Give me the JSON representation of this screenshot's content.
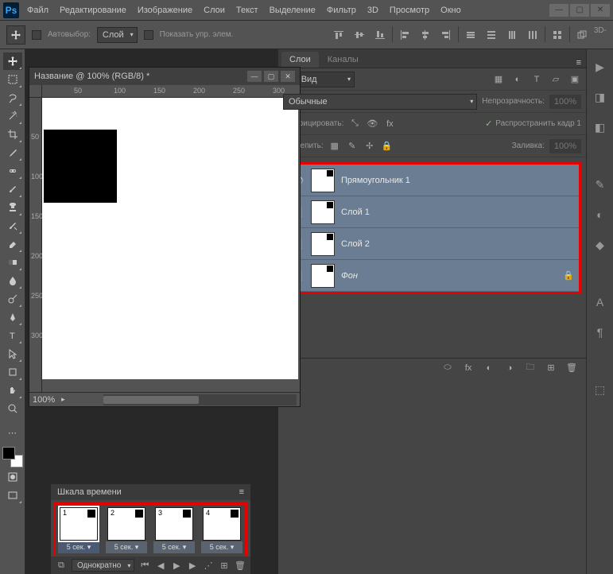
{
  "app": {
    "logo": "Ps"
  },
  "menu": [
    "Файл",
    "Редактирование",
    "Изображение",
    "Слои",
    "Текст",
    "Выделение",
    "Фильтр",
    "3D",
    "Просмотр",
    "Окно"
  ],
  "options": {
    "autoselect": "Автовыбор:",
    "autoselect_scope": "Слой",
    "show_controls": "Показать упр. элем.",
    "threeD": "3D-"
  },
  "doc": {
    "title": "Название @ 100% (RGB/8) *",
    "ruler_h": [
      "50",
      "100",
      "150",
      "200",
      "250",
      "300"
    ],
    "ruler_v": [
      "50",
      "100",
      "150",
      "200",
      "250",
      "300"
    ],
    "zoom": "100%"
  },
  "layers_panel": {
    "tabs": [
      "Слои",
      "Каналы"
    ],
    "search_label": "Вид",
    "blend": "Обычные",
    "opacity_label": "Непрозрачность:",
    "opacity_val": "100%",
    "unify_label": "Унифицировать:",
    "propagate": "Распространить кадр 1",
    "lock_label": "Закрепить:",
    "fill_label": "Заливка:",
    "fill_val": "100%",
    "layers": [
      {
        "name": "Прямоугольник 1",
        "visible": true,
        "locked": false
      },
      {
        "name": "Слой 1",
        "visible": false,
        "locked": false
      },
      {
        "name": "Слой 2",
        "visible": false,
        "locked": false
      },
      {
        "name": "Фон",
        "visible": false,
        "locked": true,
        "italic": true
      }
    ]
  },
  "timeline": {
    "title": "Шкала времени",
    "frames": [
      {
        "n": "1",
        "delay": "5 сек. ▾",
        "sel": true
      },
      {
        "n": "2",
        "delay": "5 сек. ▾",
        "sel": false
      },
      {
        "n": "3",
        "delay": "5 сек. ▾",
        "sel": false
      },
      {
        "n": "4",
        "delay": "5 сек. ▾",
        "sel": false
      }
    ],
    "loop": "Однократно"
  }
}
